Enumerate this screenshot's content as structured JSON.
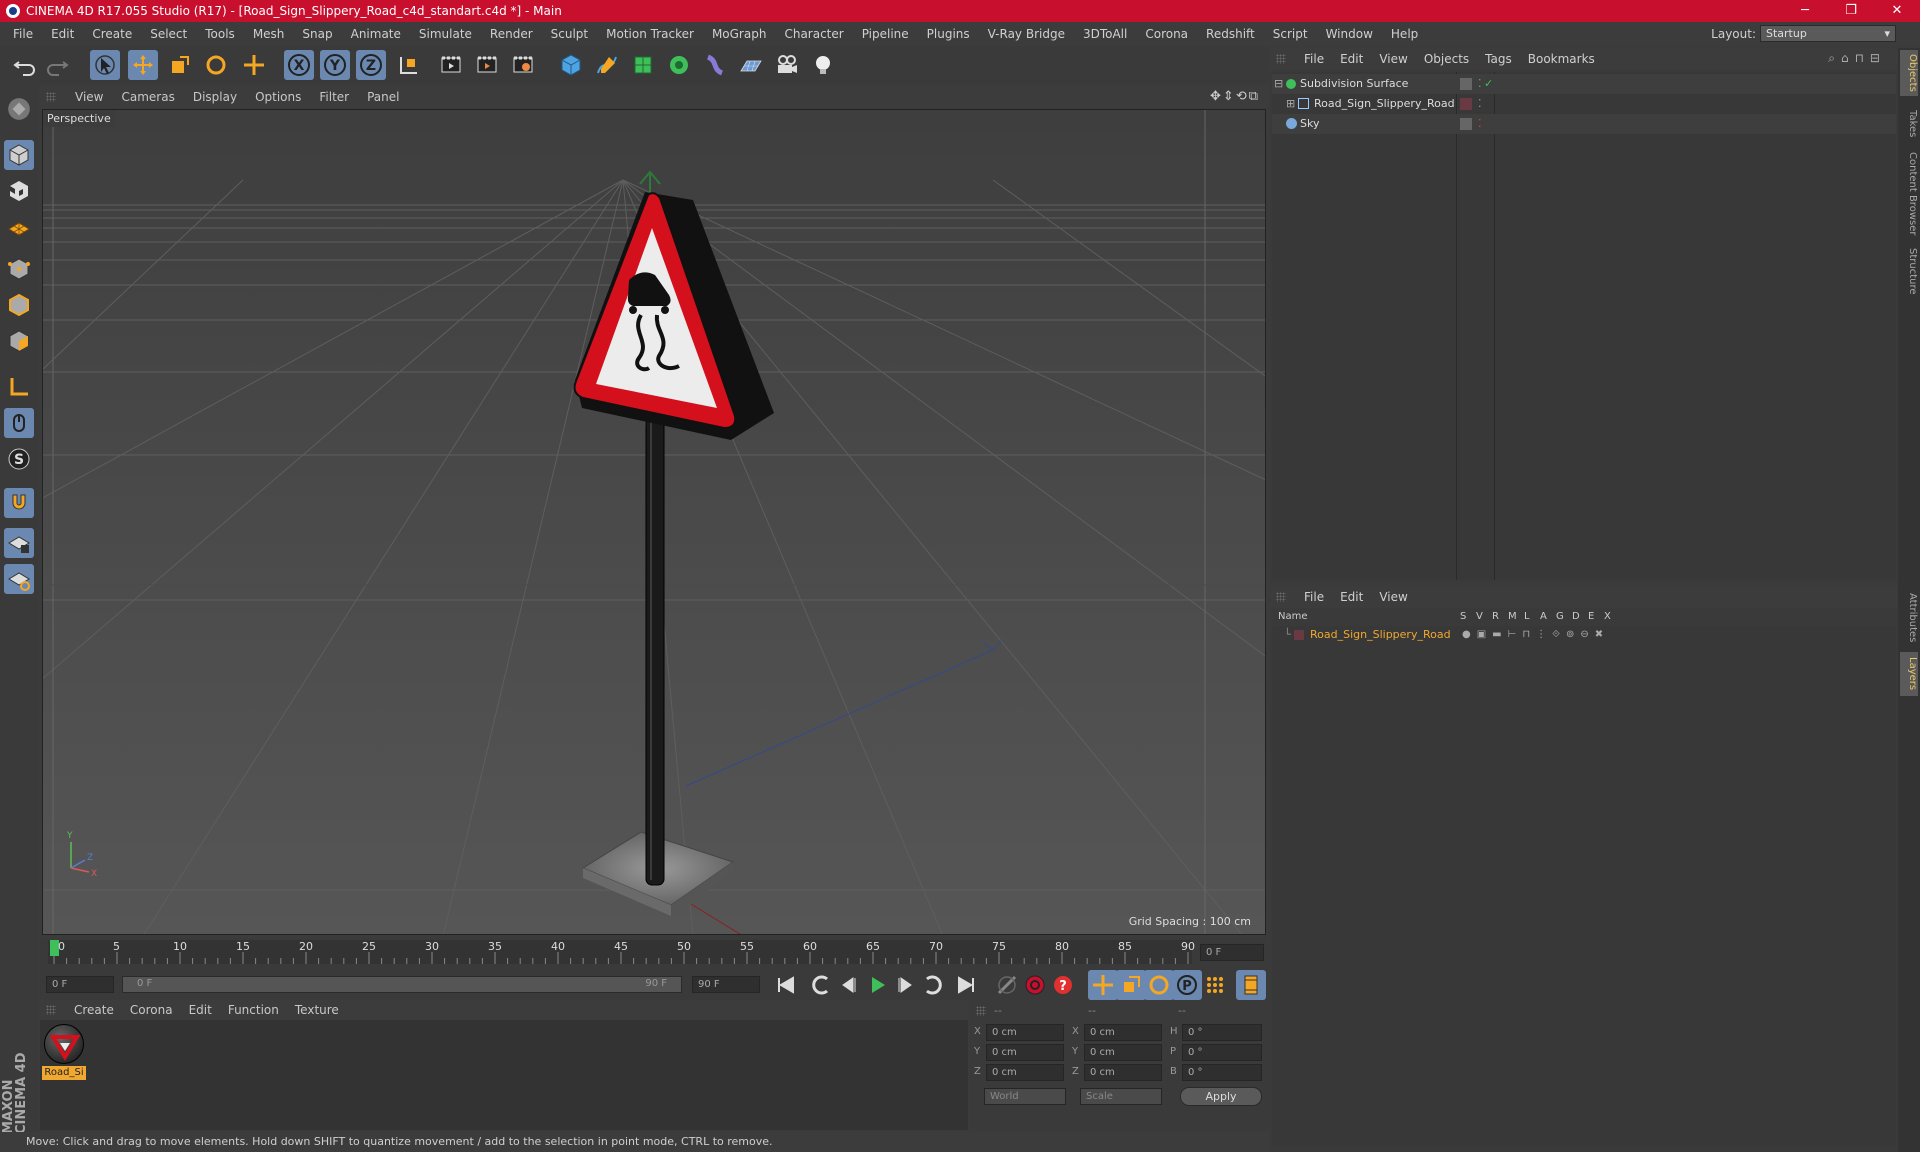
{
  "window": {
    "title": "CINEMA 4D R17.055 Studio (R17) - [Road_Sign_Slippery_Road_c4d_standart.c4d *] - Main",
    "minimize": "─",
    "maximize": "❐",
    "close": "✕"
  },
  "menubar": {
    "items": [
      "File",
      "Edit",
      "Create",
      "Select",
      "Tools",
      "Mesh",
      "Snap",
      "Animate",
      "Simulate",
      "Render",
      "Sculpt",
      "Motion Tracker",
      "MoGraph",
      "Character",
      "Pipeline",
      "Plugins",
      "V-Ray Bridge",
      "3DToAll",
      "Corona",
      "Redshift",
      "Script",
      "Window",
      "Help"
    ],
    "layout_label": "Layout:",
    "layout_value": "Startup"
  },
  "viewport": {
    "menu": [
      "View",
      "Cameras",
      "Display",
      "Options",
      "Filter",
      "Panel"
    ],
    "label": "Perspective",
    "grid_spacing": "Grid Spacing : 100 cm"
  },
  "timeline": {
    "ticks": [
      "0",
      "5",
      "10",
      "15",
      "20",
      "25",
      "30",
      "35",
      "40",
      "45",
      "50",
      "55",
      "60",
      "65",
      "70",
      "75",
      "80",
      "85",
      "90"
    ],
    "current_frame": "0 F",
    "start_field": "0 F",
    "slider_start": "0 F",
    "slider_end": "90 F",
    "end_field": "90 F"
  },
  "materials": {
    "menu": [
      "Create",
      "Corona",
      "Edit",
      "Function",
      "Texture"
    ],
    "items": [
      {
        "label": "Road_Si"
      }
    ]
  },
  "coordinates": {
    "header": [
      "--",
      "--",
      "--"
    ],
    "rows": [
      {
        "a": "X",
        "av": "0 cm",
        "b": "X",
        "bv": "0 cm",
        "c": "H",
        "cv": "0 °"
      },
      {
        "a": "Y",
        "av": "0 cm",
        "b": "Y",
        "bv": "0 cm",
        "c": "P",
        "cv": "0 °"
      },
      {
        "a": "Z",
        "av": "0 cm",
        "b": "Z",
        "bv": "0 cm",
        "c": "B",
        "cv": "0 °"
      }
    ],
    "world": "World",
    "scale": "Scale",
    "apply": "Apply"
  },
  "status": "Move: Click and drag to move elements. Hold down SHIFT to quantize movement / add to the selection in point mode, CTRL to remove.",
  "objects": {
    "menu": [
      "File",
      "Edit",
      "View",
      "Objects",
      "Tags",
      "Bookmarks"
    ],
    "rows": [
      {
        "name": "Subdivision Surface",
        "color": "#3fbf5a"
      },
      {
        "name": "Road_Sign_Slippery_Road",
        "color": "#9acbff"
      },
      {
        "name": "Sky",
        "color": "#7aa8d8"
      }
    ]
  },
  "layers": {
    "menu": [
      "File",
      "Edit",
      "View"
    ],
    "columns": [
      "Name",
      "S",
      "V",
      "R",
      "M",
      "L",
      "A",
      "G",
      "D",
      "E",
      "X"
    ],
    "rows": [
      {
        "name": "Road_Sign_Slippery_Road",
        "color": "#e8a23a"
      }
    ]
  },
  "right_tabs": [
    "Objects",
    "Takes",
    "Content Browser",
    "Structure",
    "Attributes",
    "Layers"
  ],
  "brand": "MAXON CINEMA 4D",
  "colors": {
    "accent": "#6a88b0",
    "title_red": "#c8102e",
    "selected_text": "#f0a830"
  }
}
